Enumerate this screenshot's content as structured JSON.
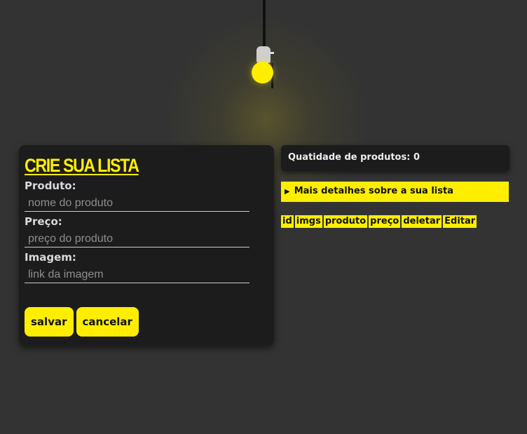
{
  "form": {
    "title": "Crie sua lista",
    "fields": [
      {
        "label": "Produto:",
        "placeholder": "nome do produto"
      },
      {
        "label": "Preço:",
        "placeholder": "preço do produto"
      },
      {
        "label": "Imagem:",
        "placeholder": "link da imagem"
      }
    ],
    "save_label": "salvar",
    "cancel_label": "cancelar"
  },
  "summary": {
    "count_text": "Quatidade de produtos: 0",
    "details_label": "Mais detalhes sobre a sua lista",
    "details_icon": "triangle-right-icon"
  },
  "table": {
    "headers": [
      "id",
      "imgs",
      "produto",
      "preço",
      "deletar",
      "Editar"
    ]
  },
  "colors": {
    "accent": "#ffee00",
    "background": "#333333",
    "card": "#1c1c1c"
  }
}
